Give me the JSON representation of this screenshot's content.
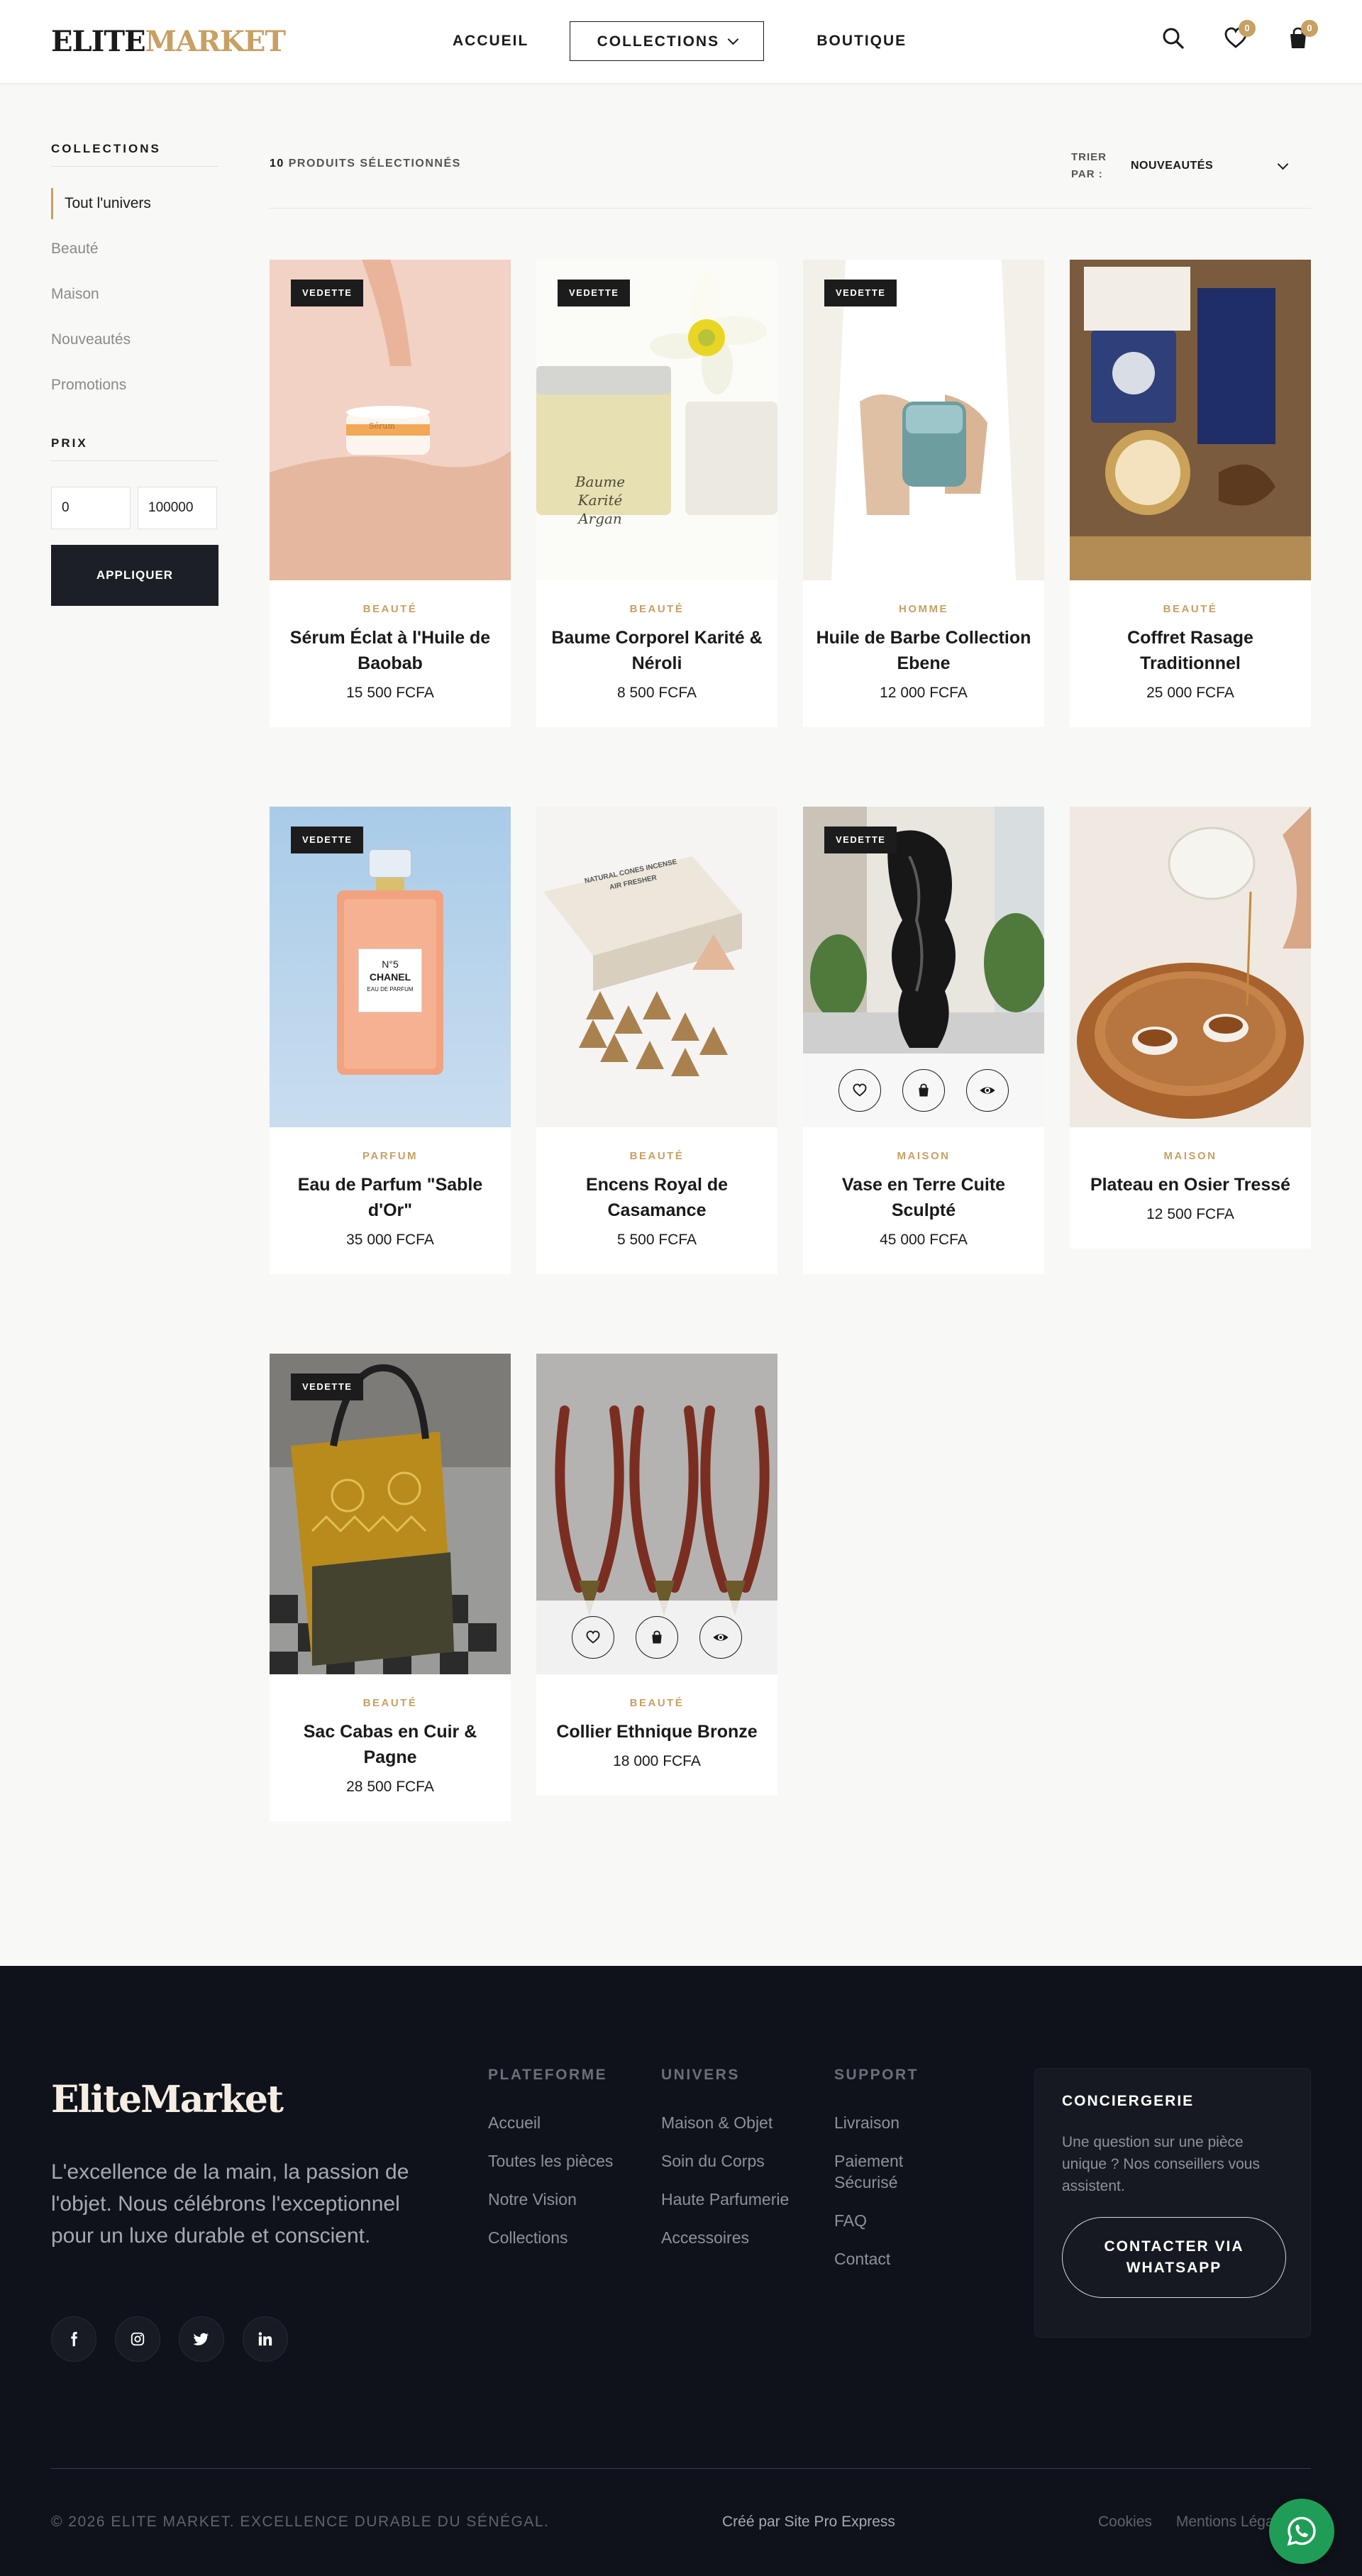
{
  "brand": {
    "part1": "ELITE",
    "part2": "MARKET",
    "accent_color": "#c7a063"
  },
  "nav": {
    "home": "ACCUEIL",
    "collections": "COLLECTIONS",
    "shop": "BOUTIQUE"
  },
  "header_icons": {
    "search": "search-icon",
    "wishlist": "heart-icon",
    "wishlist_count": "0",
    "cart": "bag-icon",
    "cart_count": "0"
  },
  "sidebar": {
    "collections_heading": "COLLECTIONS",
    "items": [
      {
        "label": "Tout l'univers",
        "active": true
      },
      {
        "label": "Beauté",
        "active": false
      },
      {
        "label": "Maison",
        "active": false
      },
      {
        "label": "Nouveautés",
        "active": false
      },
      {
        "label": "Promotions",
        "active": false
      }
    ],
    "price_heading": "PRIX",
    "price_min": "0",
    "price_max": "100000",
    "apply_label": "APPLIQUER"
  },
  "toolbar": {
    "count_number": "10",
    "count_label": "PRODUITS SÉLECTIONNÉS",
    "sort_label": "TRIER PAR :",
    "sort_value": "NOUVEAUTÉS"
  },
  "products": [
    {
      "category": "BEAUTÉ",
      "name": "Sérum Éclat à l'Huile de Baobab",
      "price": "15 500 FCFA",
      "badge": "VEDETTE"
    },
    {
      "category": "BEAUTÉ",
      "name": "Baume Corporel Karité & Néroli",
      "price": "8 500 FCFA",
      "badge": "VEDETTE"
    },
    {
      "category": "HOMME",
      "name": "Huile de Barbe Collection Ebene",
      "price": "12 000 FCFA",
      "badge": "VEDETTE"
    },
    {
      "category": "BEAUTÉ",
      "name": "Coffret Rasage Traditionnel",
      "price": "25 000 FCFA",
      "badge": ""
    },
    {
      "category": "PARFUM",
      "name": "Eau de Parfum \"Sable d'Or\"",
      "price": "35 000 FCFA",
      "badge": "VEDETTE"
    },
    {
      "category": "BEAUTÉ",
      "name": "Encens Royal de Casamance",
      "price": "5 500 FCFA",
      "badge": ""
    },
    {
      "category": "MAISON",
      "name": "Vase en Terre Cuite Sculpté",
      "price": "45 000 FCFA",
      "badge": "VEDETTE"
    },
    {
      "category": "MAISON",
      "name": "Plateau en Osier Tressé",
      "price": "12 500 FCFA",
      "badge": ""
    },
    {
      "category": "BEAUTÉ",
      "name": "Sac Cabas en Cuir & Pagne",
      "price": "28 500 FCFA",
      "badge": "VEDETTE"
    },
    {
      "category": "BEAUTÉ",
      "name": "Collier Ethnique Bronze",
      "price": "18 000 FCFA",
      "badge": ""
    }
  ],
  "product_image_text": {
    "serum_jar": "Sérum",
    "balm_line1": "Baume",
    "balm_line2": "Karité Argan",
    "perfume_line1": "N°5",
    "perfume_line2": "CHANEL",
    "perfume_line3": "EAU DE PARFUM",
    "incense_box_line1": "NATURAL CONES INCENSE",
    "incense_box_line2": "AIR FRESHER"
  },
  "card_actions": [
    "heart-icon",
    "bag-icon",
    "eye-icon"
  ],
  "footer": {
    "logo_part1": "Elite",
    "logo_part2": "Market",
    "tagline": "L'excellence de la main, la passion de l'objet. Nous célébrons l'exceptionnel pour un luxe durable et conscient.",
    "socials": [
      "facebook-icon",
      "instagram-icon",
      "twitter-icon",
      "linkedin-icon"
    ],
    "columns": [
      {
        "heading": "PLATEFORME",
        "links": [
          "Accueil",
          "Toutes les pièces",
          "Notre Vision",
          "Collections"
        ]
      },
      {
        "heading": "UNIVERS",
        "links": [
          "Maison & Objet",
          "Soin du Corps",
          "Haute Parfumerie",
          "Accessoires"
        ]
      },
      {
        "heading": "SUPPORT",
        "links": [
          "Livraison",
          "Paiement Sécurisé",
          "FAQ",
          "Contact"
        ]
      }
    ],
    "concierge": {
      "heading": "CONCIERGERIE",
      "text": "Une question sur une pièce unique ? Nos conseillers vous assistent.",
      "button": "CONTACTER VIA WHATSAPP"
    },
    "copyright": "© 2026 ELITE MARKET. EXCELLENCE DURABLE DU SÉNÉGAL.",
    "made_by": "Créé par Site Pro Express",
    "legal": [
      "Cookies",
      "Mentions Légales"
    ]
  }
}
